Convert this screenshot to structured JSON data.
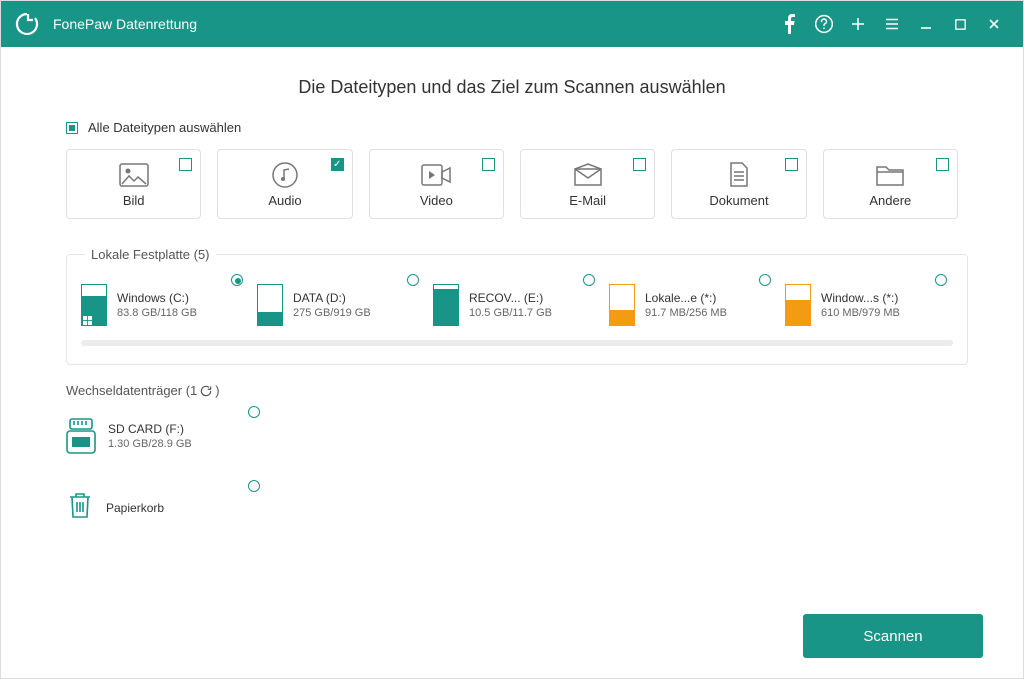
{
  "app": {
    "title": "FonePaw Datenrettung"
  },
  "heading": "Die Dateitypen und das Ziel zum Scannen auswählen",
  "selectAll": {
    "label": "Alle Dateitypen auswählen",
    "state": "partial"
  },
  "fileTypes": [
    {
      "key": "image",
      "label": "Bild",
      "checked": false
    },
    {
      "key": "audio",
      "label": "Audio",
      "checked": true
    },
    {
      "key": "video",
      "label": "Video",
      "checked": false
    },
    {
      "key": "email",
      "label": "E-Mail",
      "checked": false
    },
    {
      "key": "document",
      "label": "Dokument",
      "checked": false
    },
    {
      "key": "other",
      "label": "Andere",
      "checked": false
    }
  ],
  "localDisk": {
    "legend": "Lokale Festplatte (5)",
    "drives": [
      {
        "name": "Windows (C:)",
        "size": "83.8 GB/118 GB",
        "usedPct": 71,
        "color": "teal",
        "selected": true,
        "isSystem": true
      },
      {
        "name": "DATA (D:)",
        "size": "275 GB/919 GB",
        "usedPct": 30,
        "color": "teal",
        "selected": false,
        "isSystem": false
      },
      {
        "name": "RECOV... (E:)",
        "size": "10.5 GB/11.7 GB",
        "usedPct": 90,
        "color": "teal",
        "selected": false,
        "isSystem": false
      },
      {
        "name": "Lokale...e (*:)",
        "size": "91.7 MB/256 MB",
        "usedPct": 36,
        "color": "orange",
        "selected": false,
        "isSystem": false
      },
      {
        "name": "Window...s (*:)",
        "size": "610 MB/979 MB",
        "usedPct": 62,
        "color": "orange",
        "selected": false,
        "isSystem": false
      }
    ]
  },
  "removable": {
    "legend": "Wechseldatenträger (1",
    "drives": [
      {
        "name": "SD CARD (F:)",
        "size": "1.30 GB/28.9 GB",
        "selected": false
      }
    ]
  },
  "recycle": {
    "label": "Papierkorb",
    "selected": false
  },
  "scanButton": "Scannen",
  "colors": {
    "accent": "#199588",
    "warn": "#f39c12"
  }
}
